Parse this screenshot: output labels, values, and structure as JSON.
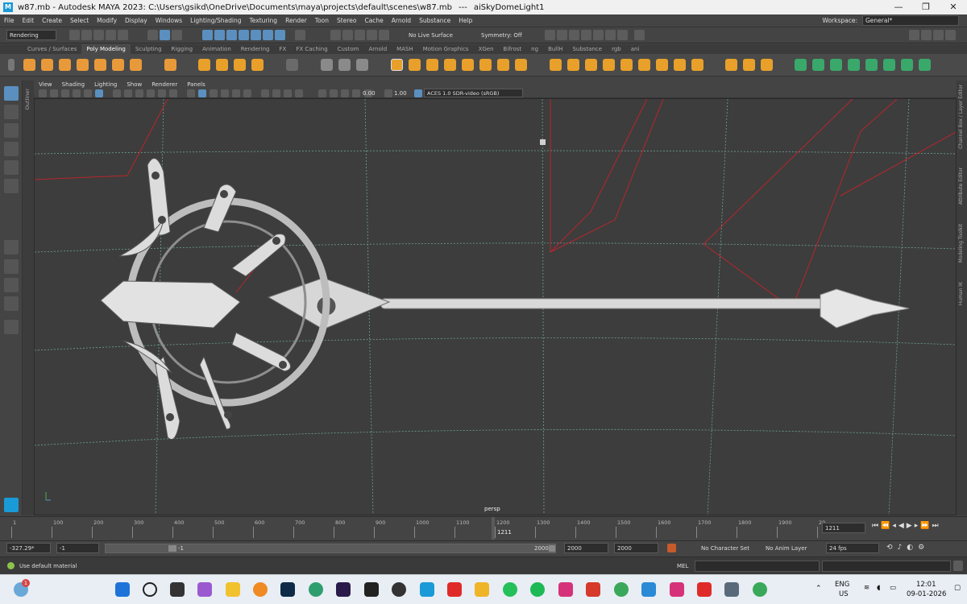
{
  "titlebar": {
    "text": "w87.mb - Autodesk MAYA 2023: C:\\Users\\gsikd\\OneDrive\\Documents\\maya\\projects\\default\\scenes\\w87.mb",
    "separator": "---",
    "selection": "aiSkyDomeLight1",
    "minimize": "—",
    "maximize": "❐",
    "close": "✕"
  },
  "menubar": {
    "items": [
      "File",
      "Edit",
      "Create",
      "Select",
      "Modify",
      "Display",
      "Windows",
      "Lighting/Shading",
      "Texturing",
      "Render",
      "Toon",
      "Stereo",
      "Cache",
      "Arnold",
      "Substance",
      "Help"
    ],
    "workspace_label": "Workspace:",
    "workspace_value": "General*"
  },
  "statusline": {
    "menuset": "Rendering",
    "live_surface": "No Live Surface",
    "symmetry": "Symmetry: Off"
  },
  "shelf": {
    "tabs": [
      "Curves / Surfaces",
      "Poly Modeling",
      "Sculpting",
      "Rigging",
      "Animation",
      "Rendering",
      "FX",
      "FX Caching",
      "Custom",
      "Arnold",
      "MASH",
      "Motion Graphics",
      "XGen",
      "Bifrost",
      "ng",
      "BullH",
      "Substance",
      "rgb",
      "ani"
    ],
    "active_tab": "Poly Modeling"
  },
  "panel": {
    "menus": [
      "View",
      "Shading",
      "Lighting",
      "Show",
      "Renderer",
      "Panels"
    ],
    "exposure": "0.00",
    "gamma": "1.00",
    "color_space": "ACES 1.0 SDR-video (sRGB)",
    "camera_label": "persp"
  },
  "right_tabs": [
    "Channel Box / Layer Editor",
    "Attribute Editor",
    "Modeling Toolkit",
    "Human IK"
  ],
  "outliner_tab": "Outliner",
  "timeslider": {
    "ticks": [
      "1",
      "100",
      "200",
      "300",
      "400",
      "500",
      "600",
      "700",
      "800",
      "900",
      "1000",
      "1100",
      "1200",
      "1300",
      "1400",
      "1500",
      "1600",
      "1700",
      "1800",
      "1900",
      "20"
    ],
    "current_frame_marker": "1211",
    "current_frame": "1211"
  },
  "range": {
    "coord": "-327.29*",
    "start": "-1",
    "slider_start": "-1",
    "slider_end": "2000",
    "end": "2000",
    "anim_end": "2000",
    "character_set": "No Character Set",
    "anim_layer": "No Anim Layer",
    "fps": "24 fps"
  },
  "cmdline": {
    "help": "Use default material",
    "lang": "MEL"
  },
  "taskbar": {
    "lang_top": "ENG",
    "lang_bottom": "US",
    "time": "12:01",
    "date": "09-01-2026",
    "notif_count": "1"
  },
  "colors": {
    "accent": "#5a8fbf",
    "viewport_bg": "#3d3d3d",
    "grid": "#7fc4b4",
    "red_lines": "#b8262c"
  }
}
